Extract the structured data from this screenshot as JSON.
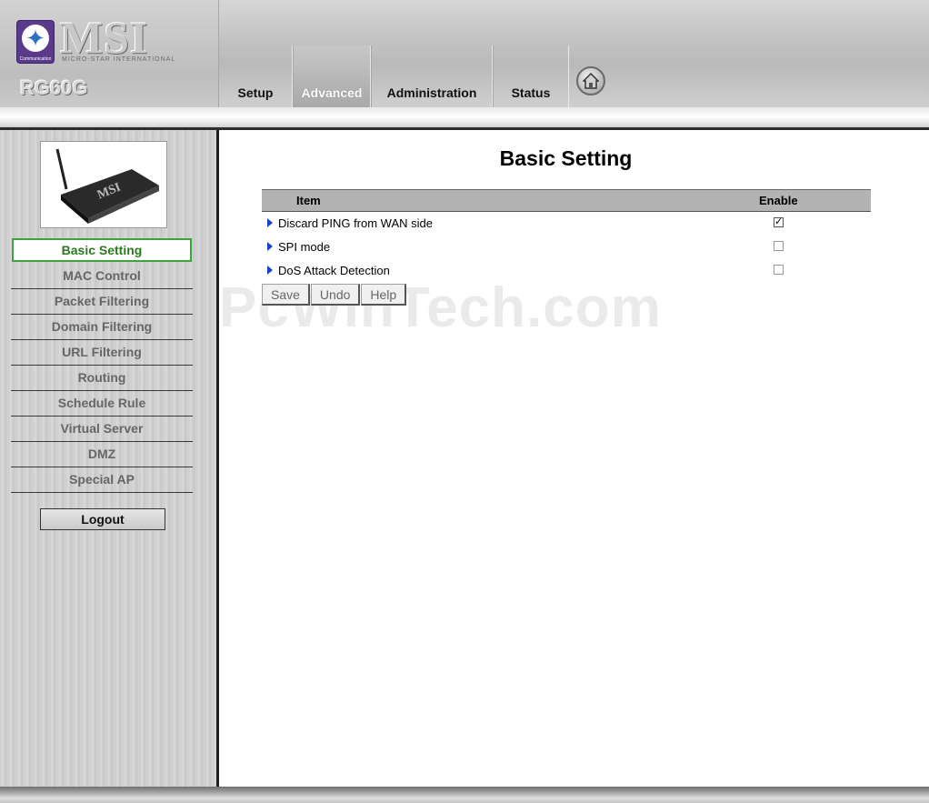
{
  "brand": {
    "logo_text": "MSI",
    "logo_sub": "MICRO-STAR INTERNATIONAL",
    "badge_text": "Communication",
    "model": "RG60G"
  },
  "nav": {
    "tabs": [
      {
        "label": "Setup"
      },
      {
        "label": "Advanced",
        "active": true
      },
      {
        "label": "Administration"
      },
      {
        "label": "Status"
      }
    ],
    "home_icon": "home-icon"
  },
  "sidebar": {
    "items": [
      {
        "label": "Basic Setting",
        "active": true
      },
      {
        "label": "MAC Control"
      },
      {
        "label": "Packet Filtering"
      },
      {
        "label": "Domain Filtering"
      },
      {
        "label": "URL Filtering"
      },
      {
        "label": "Routing"
      },
      {
        "label": "Schedule Rule"
      },
      {
        "label": "Virtual Server"
      },
      {
        "label": "DMZ"
      },
      {
        "label": "Special AP"
      }
    ],
    "logout_label": "Logout"
  },
  "main": {
    "title": "Basic Setting",
    "table": {
      "col_item": "Item",
      "col_enable": "Enable",
      "rows": [
        {
          "label": "Discard PING from WAN side",
          "checked": true
        },
        {
          "label": "SPI mode",
          "checked": false
        },
        {
          "label": "DoS Attack Detection",
          "checked": false
        }
      ]
    },
    "buttons": {
      "save": "Save",
      "undo": "Undo",
      "help": "Help"
    },
    "watermark": "PcWinTech.com"
  },
  "colors": {
    "active_menu_border": "#3ea33e",
    "active_menu_text": "#2a7a1f",
    "arrow": "#1a3fd8"
  }
}
